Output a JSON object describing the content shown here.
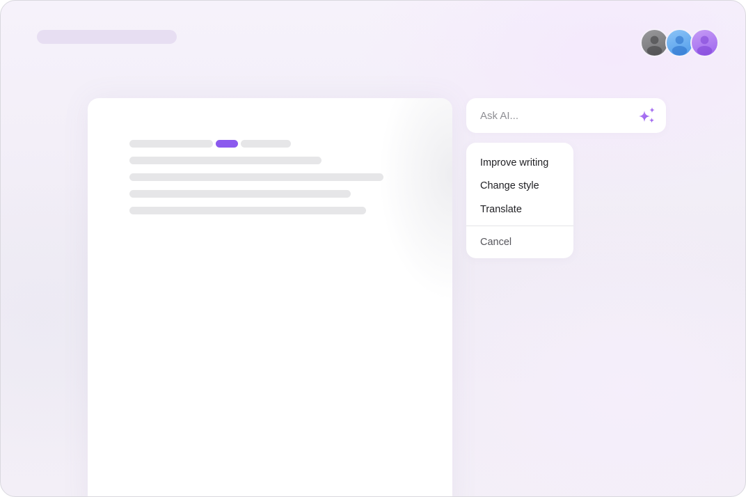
{
  "header": {
    "avatars": [
      {
        "name": "avatar-gray",
        "color": "#8a8a8c"
      },
      {
        "name": "avatar-blue",
        "color": "#6aaff0"
      },
      {
        "name": "avatar-purple",
        "color": "#b07ff2"
      }
    ]
  },
  "ask_ai": {
    "placeholder": "Ask AI...",
    "icon": "sparkle-icon",
    "accent": "#9a64ee"
  },
  "menu": {
    "items": [
      {
        "label": "Improve writing"
      },
      {
        "label": "Change style"
      },
      {
        "label": "Translate"
      }
    ],
    "cancel_label": "Cancel"
  },
  "colors": {
    "highlight": "#8b59ee",
    "skeleton": "#e6e6e8",
    "title_skeleton": "#e7def2"
  }
}
